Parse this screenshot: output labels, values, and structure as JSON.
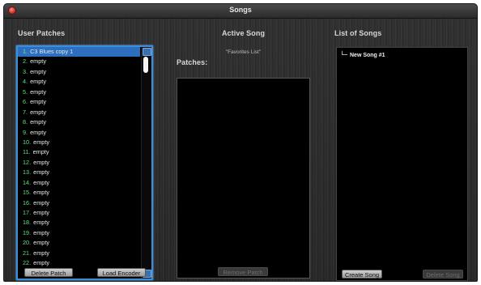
{
  "window": {
    "title": "Songs"
  },
  "headings": {
    "user_patches": "User Patches",
    "active_song": "Active Song",
    "active_song_name": "\"Favorites List\"",
    "patches": "Patches:",
    "list_of_songs": "List of Songs"
  },
  "user_patches": {
    "items": [
      {
        "num": "1.",
        "name": "C3 Blues copy 1",
        "selected": true
      },
      {
        "num": "2.",
        "name": "empty"
      },
      {
        "num": "3.",
        "name": "empty"
      },
      {
        "num": "4.",
        "name": "empty"
      },
      {
        "num": "5.",
        "name": "empty"
      },
      {
        "num": "6.",
        "name": "empty"
      },
      {
        "num": "7.",
        "name": "empty"
      },
      {
        "num": "8.",
        "name": "empty"
      },
      {
        "num": "9.",
        "name": "empty"
      },
      {
        "num": "10.",
        "name": "empty"
      },
      {
        "num": "11.",
        "name": "empty"
      },
      {
        "num": "12.",
        "name": "empty"
      },
      {
        "num": "13.",
        "name": "empty"
      },
      {
        "num": "14.",
        "name": "empty"
      },
      {
        "num": "15.",
        "name": "empty"
      },
      {
        "num": "16.",
        "name": "empty"
      },
      {
        "num": "17.",
        "name": "empty"
      },
      {
        "num": "18.",
        "name": "empty"
      },
      {
        "num": "19.",
        "name": "empty"
      },
      {
        "num": "20.",
        "name": "empty"
      },
      {
        "num": "21.",
        "name": "empty"
      },
      {
        "num": "22.",
        "name": "empty"
      }
    ],
    "delete_label": "Delete Patch",
    "load_label": "Load Encoder"
  },
  "active_song": {
    "remove_label": "Remove Patch"
  },
  "songs": {
    "items": [
      "New Song #1"
    ],
    "create_label": "Create Song",
    "delete_label": "Delete Song"
  },
  "colors": {
    "selection": "#2d6fbf",
    "number": "#5fe07a",
    "focus_border": "#3c8fd8"
  }
}
